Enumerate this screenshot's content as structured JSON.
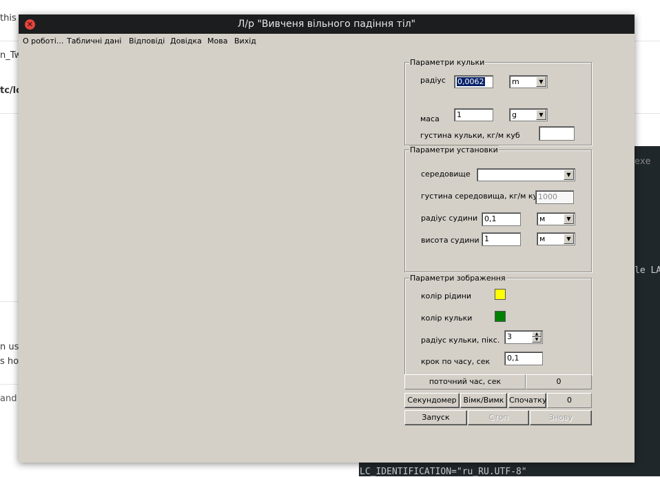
{
  "background": {
    "left_fragments": [
      "this",
      "n_Tw",
      "tc/lo",
      "n use",
      "s how",
      "and"
    ],
    "right_fragments": [
      "exe",
      "le LA"
    ],
    "terminal_bottom": "LC_IDENTIFICATION=\"ru_RU.UTF-8\""
  },
  "window": {
    "title": "Л/р \"Вивченя вільного падіння тіл\"",
    "close_icon": "✕"
  },
  "menu": {
    "about": "О роботі...",
    "tables": "Табличні дані",
    "answers": "Відповіді",
    "help": "Довідка",
    "language": "Мова",
    "exit": "Вихід"
  },
  "ball_params": {
    "title": "Параметри кульки",
    "radius_label": "радіус",
    "radius_value": "0,0062",
    "radius_unit": "m",
    "mass_label": "маса",
    "mass_value": "1",
    "mass_unit": "g",
    "density_label": "густина кульки, кг/м куб",
    "density_value": ""
  },
  "setup_params": {
    "title": "Параметри установки",
    "medium_label": "середовище",
    "medium_value": "",
    "medium_density_label": "густина середовища, кг/м куб",
    "medium_density_value": "1000",
    "vessel_radius_label": "радіус судини",
    "vessel_radius_value": "0,1",
    "vessel_radius_unit": "м",
    "vessel_height_label": "висота судини",
    "vessel_height_value": "1",
    "vessel_height_unit": "м"
  },
  "display_params": {
    "title": "Параметри зображення",
    "liquid_color_label": "колір рідини",
    "liquid_color": "#ffff00",
    "ball_color_label": "колір кульки",
    "ball_color": "#008000",
    "ball_radius_label": "радіус кульки, пікс.",
    "ball_radius_value": "3",
    "time_step_label": "крок по часу, сек",
    "time_step_value": "0,1"
  },
  "status": {
    "current_time_label": "поточний час, сек",
    "current_time_value": "0",
    "stopwatch_label": "Секундомер",
    "onoff_label": "Вімк/Вимк",
    "reset_label": "Спочатку",
    "stopwatch_value": "0"
  },
  "controls": {
    "start_label": "Запуск",
    "stop_label": "Стоп",
    "again_label": "Знову"
  }
}
